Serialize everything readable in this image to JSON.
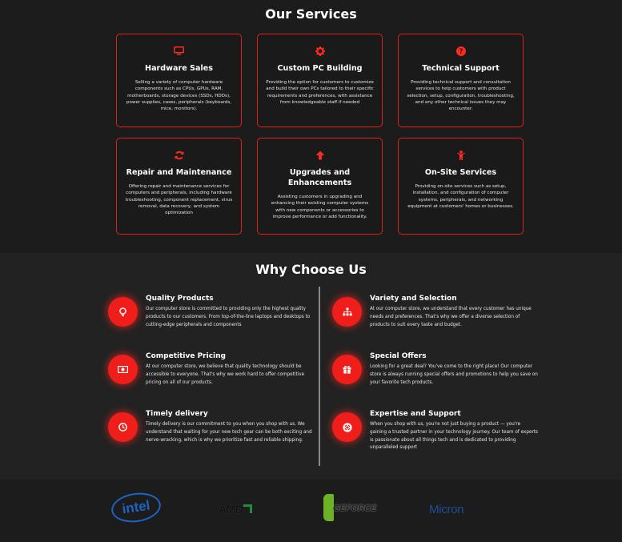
{
  "services": {
    "title": "Our Services",
    "items": [
      {
        "icon": "monitor-icon",
        "title": "Hardware Sales",
        "description": "Selling a variety of computer hardware components such as CPUs, GPUs, RAM, motherboards, storage devices (SSDs, HDDs), power supplies, cases, peripherals (keyboards, mice, monitors)."
      },
      {
        "icon": "gear-icon",
        "title": "Custom PC Building",
        "description": "Providing the option for customers to customize and build their own PCs tailored to their specific requirements and preferences, with assistance from knowledgeable staff if needed"
      },
      {
        "icon": "question-circle-icon",
        "title": "Technical Support",
        "description": "Providing technical support and consultation services to help customers with product selection, setup, configuration, troubleshooting, and any other technical issues they may encounter."
      },
      {
        "icon": "refresh-icon",
        "title": "Repair and Maintenance",
        "description": "Offering repair and maintenance services for computers and peripherals, including hardware troubleshooting, component replacement, virus removal, data recovery, and system optimization"
      },
      {
        "icon": "arrow-up-icon",
        "title": "Upgrades and Enhancements",
        "description": "Assisting customers in upgrading and enhancing their existing computer systems with new components or accessories to improve performance or add functionality."
      },
      {
        "icon": "person-icon",
        "title": "On-Site Services",
        "description": "Providing on-site services such as setup, installation, and configuration of computer systems, peripherals, and networking equipment at customers' homes or businesses."
      }
    ]
  },
  "why": {
    "title": "Why Choose Us",
    "features": [
      {
        "icon": "lightbulb-icon",
        "title": "Quality Products",
        "description": "Our computer store is committed to providing only the highest quality products to our customers. From top-of-the-line laptops and desktops to cutting-edge peripherals and components"
      },
      {
        "icon": "sitemap-icon",
        "title": "Variety and Selection",
        "description": "At our computer store, we understand that every customer has unique needs and preferences. That's why we offer a diverse selection of products to suit every taste and budget."
      },
      {
        "icon": "money-bill-icon",
        "title": "Competitive Pricing",
        "description": "At our computer store, we believe that quality technology should be accessible to everyone. That's why we work hard to offer competitive pricing on all of our products."
      },
      {
        "icon": "gift-icon",
        "title": "Special Offers",
        "description": "Looking for a great deal? You've come to the right place! Our computer store is always running special offers and promotions to help you save on your favorite tech products."
      },
      {
        "icon": "clock-icon",
        "title": "Timely delivery",
        "description": "Timely delivery is our commitment to you when you shop with us. We understand that waiting for your new tech gear can be both exciting and nerve-wracking, which is why we prioritize fast and reliable shipping."
      },
      {
        "icon": "life-ring-icon",
        "title": "Expertise and Support",
        "description": "When you shop with us, you're not just buying a product — you're gaining a trusted partner in your technology journey. Our team of experts is passionate about all things tech and is dedicated to providing unparalleled support"
      }
    ]
  },
  "brands": {
    "intel": "intel",
    "amd": "AMD",
    "geforce": "GEFORCE",
    "micron": "Micron"
  },
  "colors": {
    "accent": "#f01e1a",
    "background": "#1c1c1c",
    "section_alt": "#222222"
  }
}
